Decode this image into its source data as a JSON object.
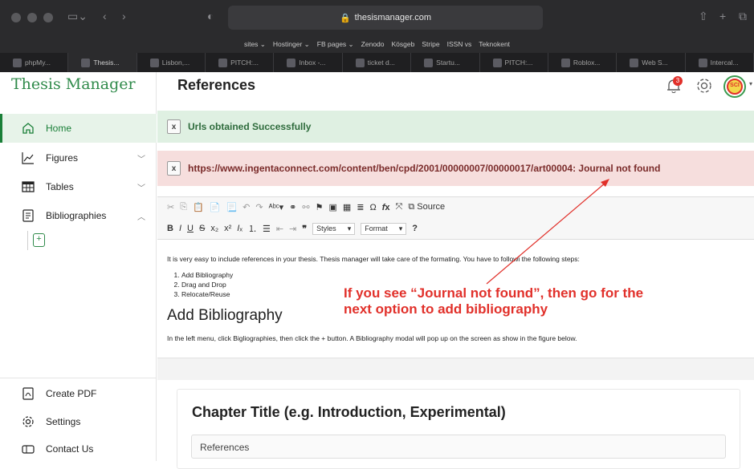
{
  "browser": {
    "url": "thesismanager.com",
    "bookmarks": [
      "sites ⌄",
      "Hostinger ⌄",
      "FB pages ⌄",
      "Zenodo",
      "Kösgeb",
      "Stripe",
      "ISSN vs",
      "Teknokent"
    ],
    "tabs": [
      "phpMy...",
      "Thesis...",
      "Lisbon,...",
      "PITCH:...",
      "Inbox -...",
      "ticket d...",
      "Startu...",
      "PITCH:...",
      "Roblox...",
      "Web S...",
      "Intercal..."
    ]
  },
  "sidebar": {
    "logo": "Thesis Manager",
    "items": [
      {
        "label": "Home"
      },
      {
        "label": "Figures"
      },
      {
        "label": "Tables"
      },
      {
        "label": "Bibliographies"
      }
    ],
    "bottom": [
      {
        "label": "Create PDF"
      },
      {
        "label": "Settings"
      },
      {
        "label": "Contact Us"
      }
    ]
  },
  "header": {
    "title": "References",
    "notification_count": "3",
    "avatar_text": "SCI"
  },
  "alerts": {
    "success": "Urls obtained Successfully",
    "danger": "https://www.ingentaconnect.com/content/ben/cpd/2001/00000007/00000017/art00004: Journal not found",
    "close": "x"
  },
  "editor": {
    "source_label": "Source",
    "styles_label": "Styles",
    "format_label": "Format",
    "intro": "It is very easy to include references in your thesis. Thesis manager will take care of the formating. You have to followi the following steps:",
    "steps": [
      "Add Bibliography",
      "Drag and Drop",
      "Relocate/Reuse"
    ],
    "heading": "Add Bibliography",
    "paragraph": "In the left menu, click Bigliographies, then click the + button. A Bibliography modal will pop up on the screen as show in the figure below."
  },
  "annotation": {
    "line1": "If you see “Journal not found”, then go for the",
    "line2": "next option to add bibliography"
  },
  "card": {
    "title": "Chapter Title (e.g. Introduction, Experimental)",
    "references_label": "References"
  }
}
